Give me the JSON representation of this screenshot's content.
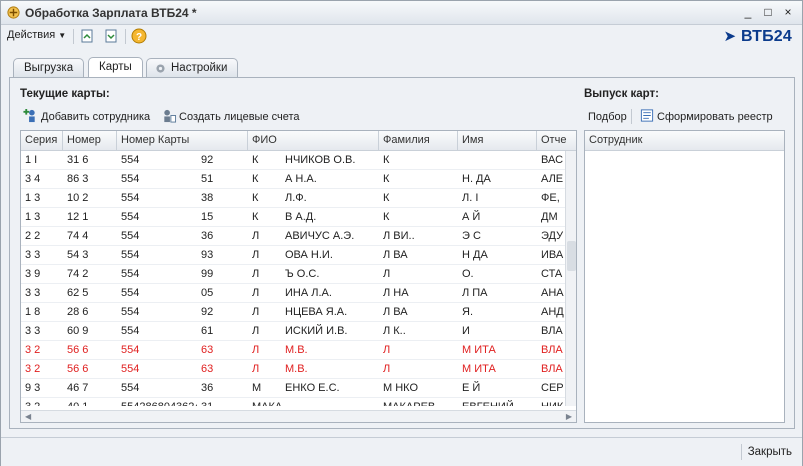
{
  "window": {
    "title": "Обработка  Зарплата ВТБ24 *",
    "controls": [
      "_",
      "□",
      "×"
    ]
  },
  "toolbar": {
    "actions_label": "Действия",
    "icons": [
      "refresh-doc-icon",
      "export-doc-icon",
      "help-icon"
    ]
  },
  "brand": {
    "name_prefix": "ВТБ",
    "name_suffix": "24",
    "color": "#0b3b8c"
  },
  "tabs": [
    {
      "label": "Выгрузка",
      "active": false
    },
    {
      "label": "Карты",
      "active": true
    },
    {
      "label": "Настройки",
      "active": false
    }
  ],
  "current_cards": {
    "title": "Текущие карты:",
    "add_employee_label": "Добавить сотрудника",
    "create_accounts_label": "Создать лицевые счета",
    "columns": [
      "Серия",
      "Номер",
      "Номер Карты",
      "ФИО",
      "Фамилия",
      "Имя",
      "Отче"
    ],
    "rows": [
      {
        "c": [
          "1  I",
          "31  6",
          "554",
          "92",
          "К",
          "НЧИКОВ О.В.",
          "К",
          "",
          "ВАС"
        ],
        "red": false
      },
      {
        "c": [
          "3  4",
          "86  3",
          "554",
          "51",
          "К",
          "А Н.А.",
          "К",
          "Н.      ДА",
          "АЛЕ"
        ],
        "red": false
      },
      {
        "c": [
          "1  3",
          "10  2",
          "554",
          "38",
          "К",
          "Л.Ф.",
          "К",
          "Л.      I",
          "ФЕ,"
        ],
        "red": false
      },
      {
        "c": [
          "1  3",
          "12  1",
          "554",
          "15",
          "К",
          "В А.Д.",
          "К",
          "А      Й",
          "ДМ"
        ],
        "red": false
      },
      {
        "c": [
          "2  2",
          "74  4",
          "554",
          "36",
          "Л",
          "АВИЧУС А.Э.",
          "Л      ВИ..",
          "Э      С",
          "ЭДУ"
        ],
        "red": false
      },
      {
        "c": [
          "3  3",
          "54  3",
          "554",
          "93",
          "Л",
          "ОВА Н.И.",
          "Л      ВА",
          "Н      ДА",
          "ИВА"
        ],
        "red": false
      },
      {
        "c": [
          "3  9",
          "74  2",
          "554",
          "99",
          "Л",
          "Ъ О.С.",
          "Л",
          "О.",
          "СТА"
        ],
        "red": false
      },
      {
        "c": [
          "3  3",
          "62  5",
          "554",
          "05",
          "Л",
          "ИНА Л.А.",
          "Л      НА",
          "Л      ПА",
          "АНА"
        ],
        "red": false
      },
      {
        "c": [
          "1  8",
          "28  6",
          "554",
          "92",
          "Л",
          "НЦЕВА Я.А.",
          "Л      ВА",
          "Я.",
          "АНД"
        ],
        "red": false
      },
      {
        "c": [
          "3  3",
          "60  9",
          "554",
          "61",
          "Л",
          "ИСКИЙ И.В.",
          "Л      К..",
          "И",
          "ВЛА"
        ],
        "red": false
      },
      {
        "c": [
          "3  2",
          "56  6",
          "554",
          "63",
          "Л",
          "М.В.",
          "Л",
          "М      ИТА",
          "ВЛА"
        ],
        "red": true
      },
      {
        "c": [
          "3  2",
          "56  6",
          "554",
          "63",
          "Л",
          "М.В.",
          "Л",
          "М      ИТА",
          "ВЛА"
        ],
        "red": true
      },
      {
        "c": [
          "9  3",
          "46  7",
          "554",
          "36",
          "М",
          "ЕНКО Е.С.",
          "М      НКО",
          "Е      Й",
          "СЕР"
        ],
        "red": false
      },
      {
        "c": [
          "3  2",
          "40  1",
          "5542868043624",
          "31",
          "МАКАРЕВ Е.Н.",
          "",
          "МАКАРЕВ",
          "ЕВГЕНИЙ",
          "НИК"
        ],
        "red": false
      }
    ]
  },
  "card_issue": {
    "title": "Выпуск карт:",
    "select_label": "Подбор",
    "register_label": "Сформировать реестр",
    "columns": [
      "Сотрудник"
    ]
  },
  "footer": {
    "close_label": "Закрыть"
  }
}
